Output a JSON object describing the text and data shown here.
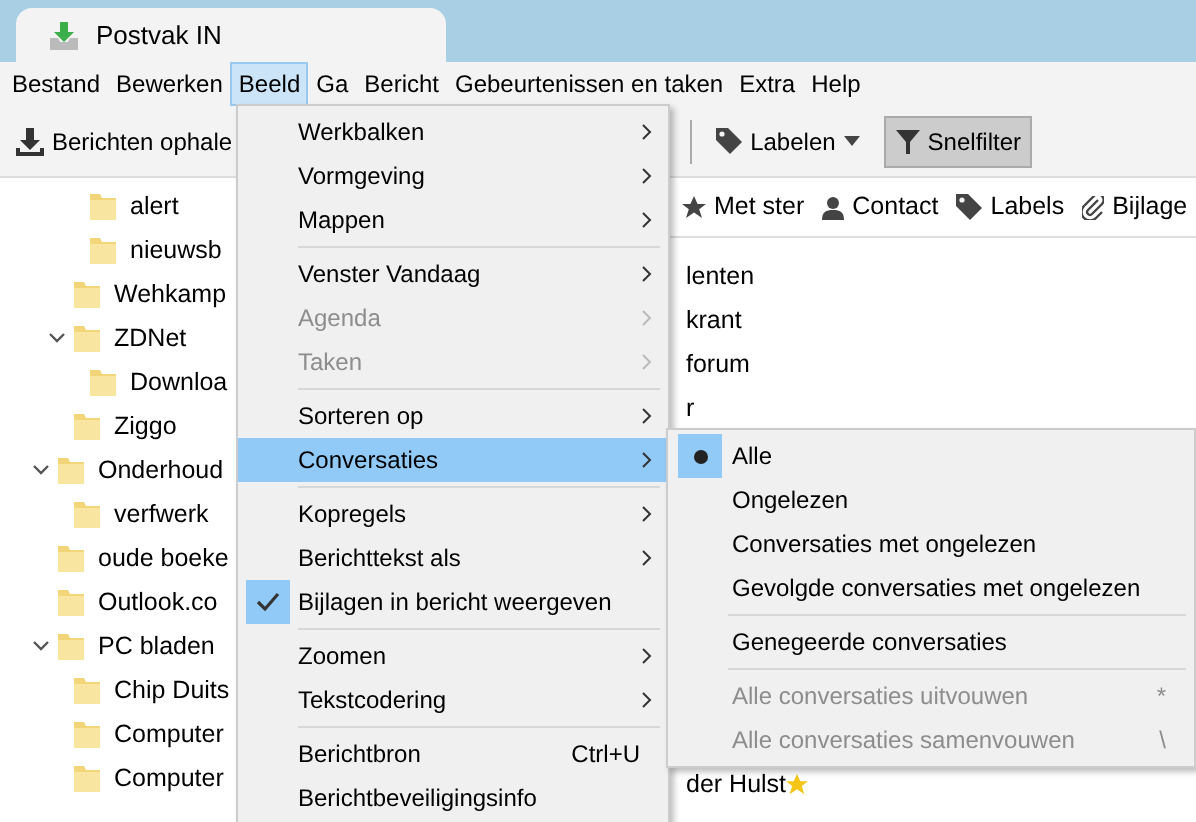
{
  "window": {
    "title": "Postvak IN"
  },
  "menubar": [
    {
      "label": "Bestand",
      "selected": false
    },
    {
      "label": "Bewerken",
      "selected": false
    },
    {
      "label": "Beeld",
      "selected": true
    },
    {
      "label": "Ga",
      "selected": false
    },
    {
      "label": "Bericht",
      "selected": false
    },
    {
      "label": "Gebeurtenissen en taken",
      "selected": false
    },
    {
      "label": "Extra",
      "selected": false
    },
    {
      "label": "Help",
      "selected": false
    }
  ],
  "toolbar": {
    "get_messages": "Berichten ophale",
    "tag": "Labelen",
    "quick_filter": {
      "label": "Snelfilter",
      "pressed": true
    }
  },
  "folders": [
    {
      "children": [
        {
          "children": [
            {
              "label": "alert"
            },
            {
              "label": "nieuwsb"
            }
          ]
        },
        {
          "label": "Wehkamp"
        },
        {
          "label": "ZDNet",
          "expanded": true,
          "children": [
            {
              "label": "Downloa"
            }
          ]
        },
        {
          "label": "Ziggo"
        }
      ]
    },
    {
      "label": "Onderhoud",
      "expanded": true,
      "children": [
        {
          "label": "verfwerk"
        }
      ]
    },
    {
      "label": "oude boeke"
    },
    {
      "label": "Outlook.co"
    },
    {
      "label": "PC bladen",
      "expanded": true,
      "children": [
        {
          "label": "Chip Duits"
        },
        {
          "label": "Computer"
        },
        {
          "label": "Computer"
        }
      ]
    }
  ],
  "quick_filter_bar": [
    {
      "kind": "star",
      "label": "Met ster"
    },
    {
      "kind": "contact",
      "label": "Contact"
    },
    {
      "kind": "tag",
      "label": "Labels"
    },
    {
      "kind": "attachment",
      "label": "Bijlage"
    }
  ],
  "messages": [
    {
      "text": "lenten",
      "starred": false
    },
    {
      "text": "krant",
      "starred": false
    },
    {
      "text": "forum",
      "starred": false
    },
    {
      "text": "r",
      "starred": false
    },
    {
      "text": "der Hulst",
      "starred": true
    }
  ],
  "view_menu": [
    {
      "kind": "item",
      "label": "Werkbalken",
      "submenu": true,
      "disabled": false,
      "highlighted": false,
      "checked": false
    },
    {
      "kind": "item",
      "label": "Vormgeving",
      "submenu": true,
      "disabled": false,
      "highlighted": false,
      "checked": false
    },
    {
      "kind": "item",
      "label": "Mappen",
      "submenu": true,
      "disabled": false,
      "highlighted": false,
      "checked": false
    },
    {
      "kind": "separator"
    },
    {
      "kind": "item",
      "label": "Venster Vandaag",
      "submenu": true,
      "disabled": false,
      "highlighted": false,
      "checked": false
    },
    {
      "kind": "item",
      "label": "Agenda",
      "submenu": true,
      "disabled": true,
      "highlighted": false,
      "checked": false
    },
    {
      "kind": "item",
      "label": "Taken",
      "submenu": true,
      "disabled": true,
      "highlighted": false,
      "checked": false
    },
    {
      "kind": "separator"
    },
    {
      "kind": "item",
      "label": "Sorteren op",
      "submenu": true,
      "disabled": false,
      "highlighted": false,
      "checked": false
    },
    {
      "kind": "item",
      "label": "Conversaties",
      "submenu": true,
      "disabled": false,
      "highlighted": true,
      "checked": false
    },
    {
      "kind": "separator"
    },
    {
      "kind": "item",
      "label": "Kopregels",
      "submenu": true,
      "disabled": false,
      "highlighted": false,
      "checked": false
    },
    {
      "kind": "item",
      "label": "Berichttekst als",
      "submenu": true,
      "disabled": false,
      "highlighted": false,
      "checked": false
    },
    {
      "kind": "item",
      "label": "Bijlagen in bericht weergeven",
      "submenu": false,
      "disabled": false,
      "highlighted": false,
      "checked": true
    },
    {
      "kind": "separator"
    },
    {
      "kind": "item",
      "label": "Zoomen",
      "submenu": true,
      "disabled": false,
      "highlighted": false,
      "checked": false
    },
    {
      "kind": "item",
      "label": "Tekstcodering",
      "submenu": true,
      "disabled": false,
      "highlighted": false,
      "checked": false
    },
    {
      "kind": "separator"
    },
    {
      "kind": "item",
      "label": "Berichtbron",
      "submenu": false,
      "disabled": false,
      "highlighted": false,
      "checked": false,
      "shortcut": "Ctrl+U"
    },
    {
      "kind": "item",
      "label": "Berichtbeveiligingsinfo",
      "submenu": false,
      "disabled": false,
      "highlighted": false,
      "checked": false
    }
  ],
  "conversations_menu": [
    {
      "kind": "radio",
      "label": "Alle",
      "selected": true
    },
    {
      "kind": "radio",
      "label": "Ongelezen",
      "selected": false
    },
    {
      "kind": "radio",
      "label": "Conversaties met ongelezen",
      "selected": false
    },
    {
      "kind": "radio",
      "label": "Gevolgde conversaties met ongelezen",
      "selected": false
    },
    {
      "kind": "separator"
    },
    {
      "kind": "radio",
      "label": "Genegeerde conversaties",
      "selected": false
    },
    {
      "kind": "separator"
    },
    {
      "kind": "item",
      "label": "Alle conversaties uitvouwen",
      "disabled": true,
      "shortcut": "*"
    },
    {
      "kind": "item",
      "label": "Alle conversaties samenvouwen",
      "disabled": true,
      "shortcut": "\\"
    }
  ]
}
